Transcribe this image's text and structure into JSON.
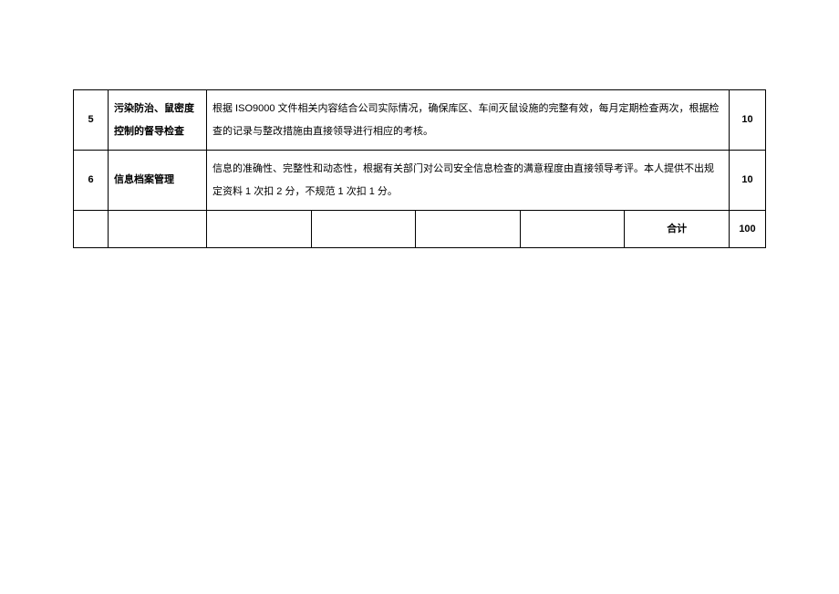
{
  "rows": [
    {
      "num": "5",
      "title": "污染防治、鼠密度控制的督导检查",
      "desc": "根据 ISO9000 文件相关内容结合公司实际情况，确保库区、车间灭鼠设施的完整有效，每月定期检查两次，根据检查的记录与整改措施由直接领导进行相应的考核。",
      "score": "10"
    },
    {
      "num": "6",
      "title": "信息档案管理",
      "desc": "信息的准确性、完整性和动态性，根据有关部门对公司安全信息检查的满意程度由直接领导考评。本人提供不出规定资料 1 次扣 2 分，不规范 1 次扣 1 分。",
      "score": "10"
    }
  ],
  "total": {
    "label": "合计",
    "value": "100"
  }
}
